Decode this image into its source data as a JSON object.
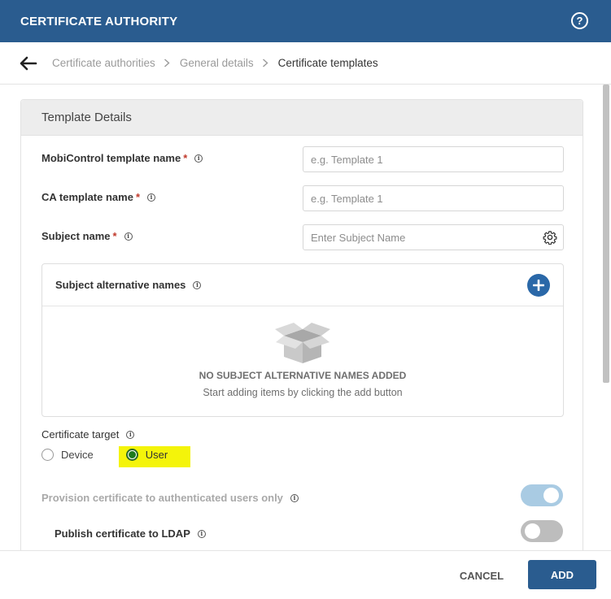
{
  "header": {
    "title": "CERTIFICATE AUTHORITY",
    "help_glyph": "?",
    "help_icon": "question-circle-icon"
  },
  "breadcrumb": {
    "items": [
      "Certificate authorities",
      "General details",
      "Certificate templates"
    ],
    "back_icon": "arrow-left-icon",
    "separator_icon": "chevron-right-icon"
  },
  "panel": {
    "title": "Template Details",
    "fields": {
      "template_name": {
        "label": "MobiControl template name",
        "required": "*",
        "placeholder": "e.g. Template 1",
        "value": ""
      },
      "ca_template_name": {
        "label": "CA template name",
        "required": "*",
        "placeholder": "e.g. Template 1",
        "value": ""
      },
      "subject_name": {
        "label": "Subject name",
        "required": "*",
        "placeholder": "Enter Subject Name",
        "value": "",
        "icon": "gear-icon"
      }
    },
    "san": {
      "title": "Subject alternative names",
      "empty_title": "NO SUBJECT ALTERNATIVE NAMES ADDED",
      "empty_subtitle": "Start adding items by clicking the add button",
      "add_icon": "plus-circle-icon",
      "empty_icon": "open-box-icon"
    },
    "certificate_target": {
      "label": "Certificate target",
      "options": [
        "Device",
        "User"
      ],
      "selected": "User",
      "highlight_color": "#f4f40a"
    },
    "provision_only": {
      "label": "Provision certificate to authenticated users only",
      "state": "on",
      "disabled": true
    },
    "publish_ldap": {
      "label": "Publish certificate to LDAP",
      "state": "off"
    },
    "info_glyph": "i"
  },
  "footer": {
    "cancel_label": "CANCEL",
    "add_label": "ADD"
  },
  "colors": {
    "header": "#2a5c8f",
    "required": "#c0392b",
    "add_button": "#2a5c8f",
    "radio_selected": "#1e7a1e"
  }
}
